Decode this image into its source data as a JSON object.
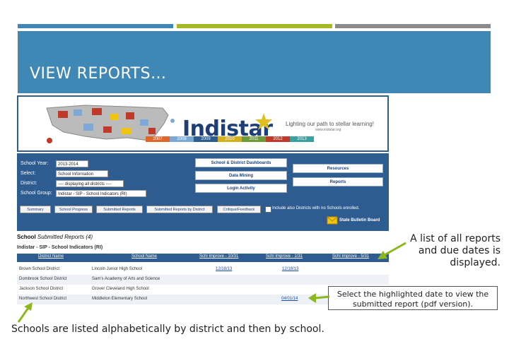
{
  "colors": {
    "accent_blue": "#3f87b5",
    "accent_green": "#a6b727",
    "accent_gray": "#8b8b8b",
    "arrow_green": "#8db81b",
    "panel_blue": "#2e5c90"
  },
  "slide": {
    "title": "VIEW REPORTS…"
  },
  "banner": {
    "logo": "Indistar",
    "tagline": "Lighting our path to stellar learning!",
    "url": "www.indistar.org",
    "years": [
      "2007",
      "2008",
      "2009",
      "2010",
      "2011",
      "2012",
      "2013"
    ]
  },
  "filters": {
    "school_year": {
      "label": "School Year:",
      "value": "2013-2014"
    },
    "select": {
      "label": "Select:",
      "value": "School Information"
    },
    "district": {
      "label": "District:",
      "value": "---- displaying all districts ----"
    },
    "school_group": {
      "label": "School Group:",
      "value": "Indistar - SIP - School Indicators (RI)"
    }
  },
  "buttons": {
    "dashboards": "School & District Dashboards",
    "data_mining": "Data Mining",
    "login_activity": "Login Activity",
    "resources": "Resources",
    "reports": "Reports"
  },
  "tabs": [
    "Summary",
    "School Progress",
    "Submitted Reports",
    "Submitted Reports by District",
    "Critique/Feedback"
  ],
  "checkbox_label": "Include also Districts with no Schools enrolled.",
  "state_bulletin": "State Bulletin Board",
  "report": {
    "heading_bold": "School",
    "heading_rest": "Submitted Reports (4)",
    "subheading": "Indistar - SIP - School Indicators (RI)",
    "columns": [
      "District Name",
      "School Name",
      "Schl Improve - 10/31",
      "Schl Improve - 1/31",
      "Schl Improve - 5/31"
    ],
    "rows": [
      {
        "district": "Brown School District",
        "school": "Lincoln Junior High School",
        "d1": "12/18/13",
        "d2": "12/18/13",
        "d3": ""
      },
      {
        "district": "Dombrook School District",
        "school": "Sam's Academy of Arts and Science",
        "d1": "",
        "d2": "",
        "d3": ""
      },
      {
        "district": "Jackson School District",
        "school": "Grover Cleveland High School",
        "d1": "",
        "d2": "",
        "d3": ""
      },
      {
        "district": "Northwest School District",
        "school": "Middleton Elementary School",
        "d1": "",
        "d2": "04/01/14",
        "d3": ""
      }
    ]
  },
  "callouts": {
    "reports_list": "A list of all reports and due dates is displayed.",
    "highlighted_date": "Select the highlighted date to view the submitted report (pdf version).",
    "sorting": "Schools are listed alphabetically by district and then by school."
  }
}
